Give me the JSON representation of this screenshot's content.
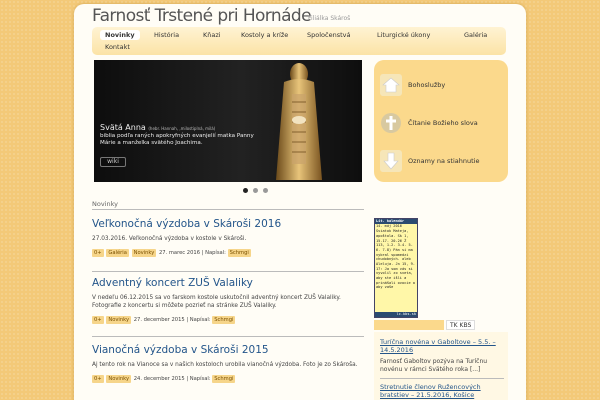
{
  "site": {
    "title": "Farnosť Trstené pri Hornáde",
    "subtitle": "Filiálka Skároš"
  },
  "nav": [
    {
      "label": "Novinky",
      "active": true
    },
    {
      "label": "História"
    },
    {
      "label": "Kňazi"
    },
    {
      "label": "Kostoly a kríže"
    },
    {
      "label": "Spoločenstvá"
    },
    {
      "label": "Liturgické úkony"
    },
    {
      "label": "Galéria"
    },
    {
      "label": "Kontakt"
    }
  ],
  "slider": {
    "title": "Svätá Anna",
    "title_note": "(hebr. Hannah, ,milostiplná, milá)",
    "text": "biblia podľa raných apokryfných evanjelií matka Panny Márie a manželka svätého Joachima.",
    "button": "wiki",
    "active_dot": 0
  },
  "quick_links": [
    {
      "label": "Bohoslužby",
      "icon": "home-icon"
    },
    {
      "label": "Čítanie Božieho slova",
      "icon": "cross-icon"
    },
    {
      "label": "Oznamy na stiahnutie",
      "icon": "download-icon"
    }
  ],
  "section_label": "Novinky",
  "articles": [
    {
      "title": "Veľkonočná výzdoba v Skároši 2016",
      "text": "27.03.2016. Veľkonočná výzdoba v kostole v Skároši.",
      "count": "0+",
      "tags": [
        "Galéria",
        "Novinky"
      ],
      "date": "27. marec 2016",
      "author_label": "Napísal:",
      "author": "Schmgi"
    },
    {
      "title": "Adventný koncert ZUŠ Valaliky",
      "text": "V nedeľu 06.12.2015 sa vo farskom kostole uskutočnil adventný koncert ZUŠ Valaliky. Fotografie z koncertu si môžete pozrieť na stránke ZUŠ Valaliky.",
      "count": "0+",
      "tags": [
        "Novinky"
      ],
      "date": "27. december 2015",
      "author_label": "Napísal:",
      "author": "Schmgi"
    },
    {
      "title": "Vianočná výzdoba v Skároši 2015",
      "text": "Aj tento rok na Vianoce sa v našich kostoloch urobila vianočná výzdoba. Foto je zo Skároša.",
      "count": "0+",
      "tags": [
        "Novinky"
      ],
      "date": "24. december 2015",
      "author_label": "Napísal:",
      "author": "Schmgi"
    }
  ],
  "calendar": {
    "header": "Lit. kalendár",
    "date": "14. máj 2016",
    "body": "Sviatok Mateja, apoštola. Sk 1, 15-17. 20-26 Ž 113, 1-2. 3-4. 5-6. 7-8) Pán si ma vybral spomedzi chudobných. aleb Aleluja. Jn 15, 9-17: Ja som vás si vyvolil zo sveta, aby ste išli a prinášali ovocie a aby vaše",
    "footer": "lc.kbs.sk"
  },
  "side_tabs": [
    {
      "label": "",
      "active": false
    },
    {
      "label": "TK KBS",
      "active": true
    }
  ],
  "news": [
    {
      "link": "Turíčna novéna v Gaboltove – 5.5. – 14.5.2016",
      "text": "Farnosť Gaboltov pozýva na Turíčnu novénu v rámci Svätého roka [...]"
    },
    {
      "link": "Stretnutie členov Ružencových bratstiev – 21.5.2016, Košice",
      "text": ""
    }
  ]
}
